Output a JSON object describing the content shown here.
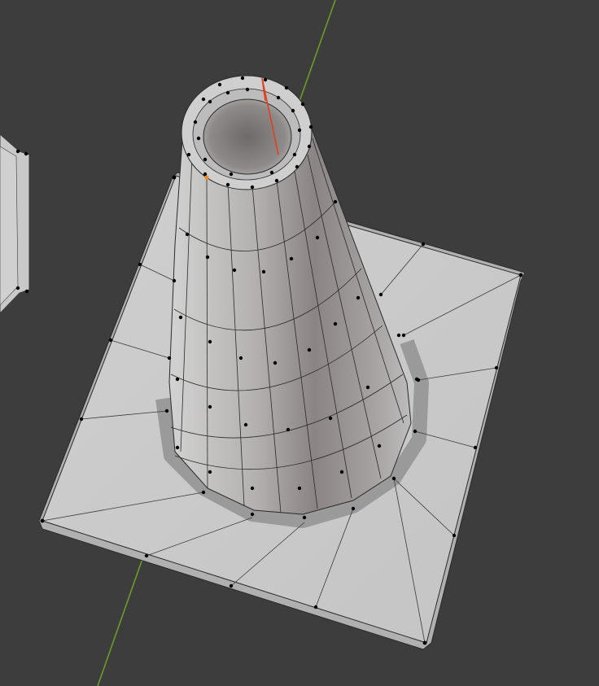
{
  "viewport": {
    "background": "#3d3d3d",
    "axis_color": "#6e9a2c",
    "selected_edge_color": "#e0401c",
    "active_vertex_color": "#f08a24",
    "vertex_color": "#000000",
    "wire_color": "#2a2a2a",
    "mesh_color": "#c9c9c9"
  },
  "scene": {
    "main_object": "traffic-cone-mesh",
    "side_object": "octagon-mesh",
    "mode": "edit-mode"
  }
}
